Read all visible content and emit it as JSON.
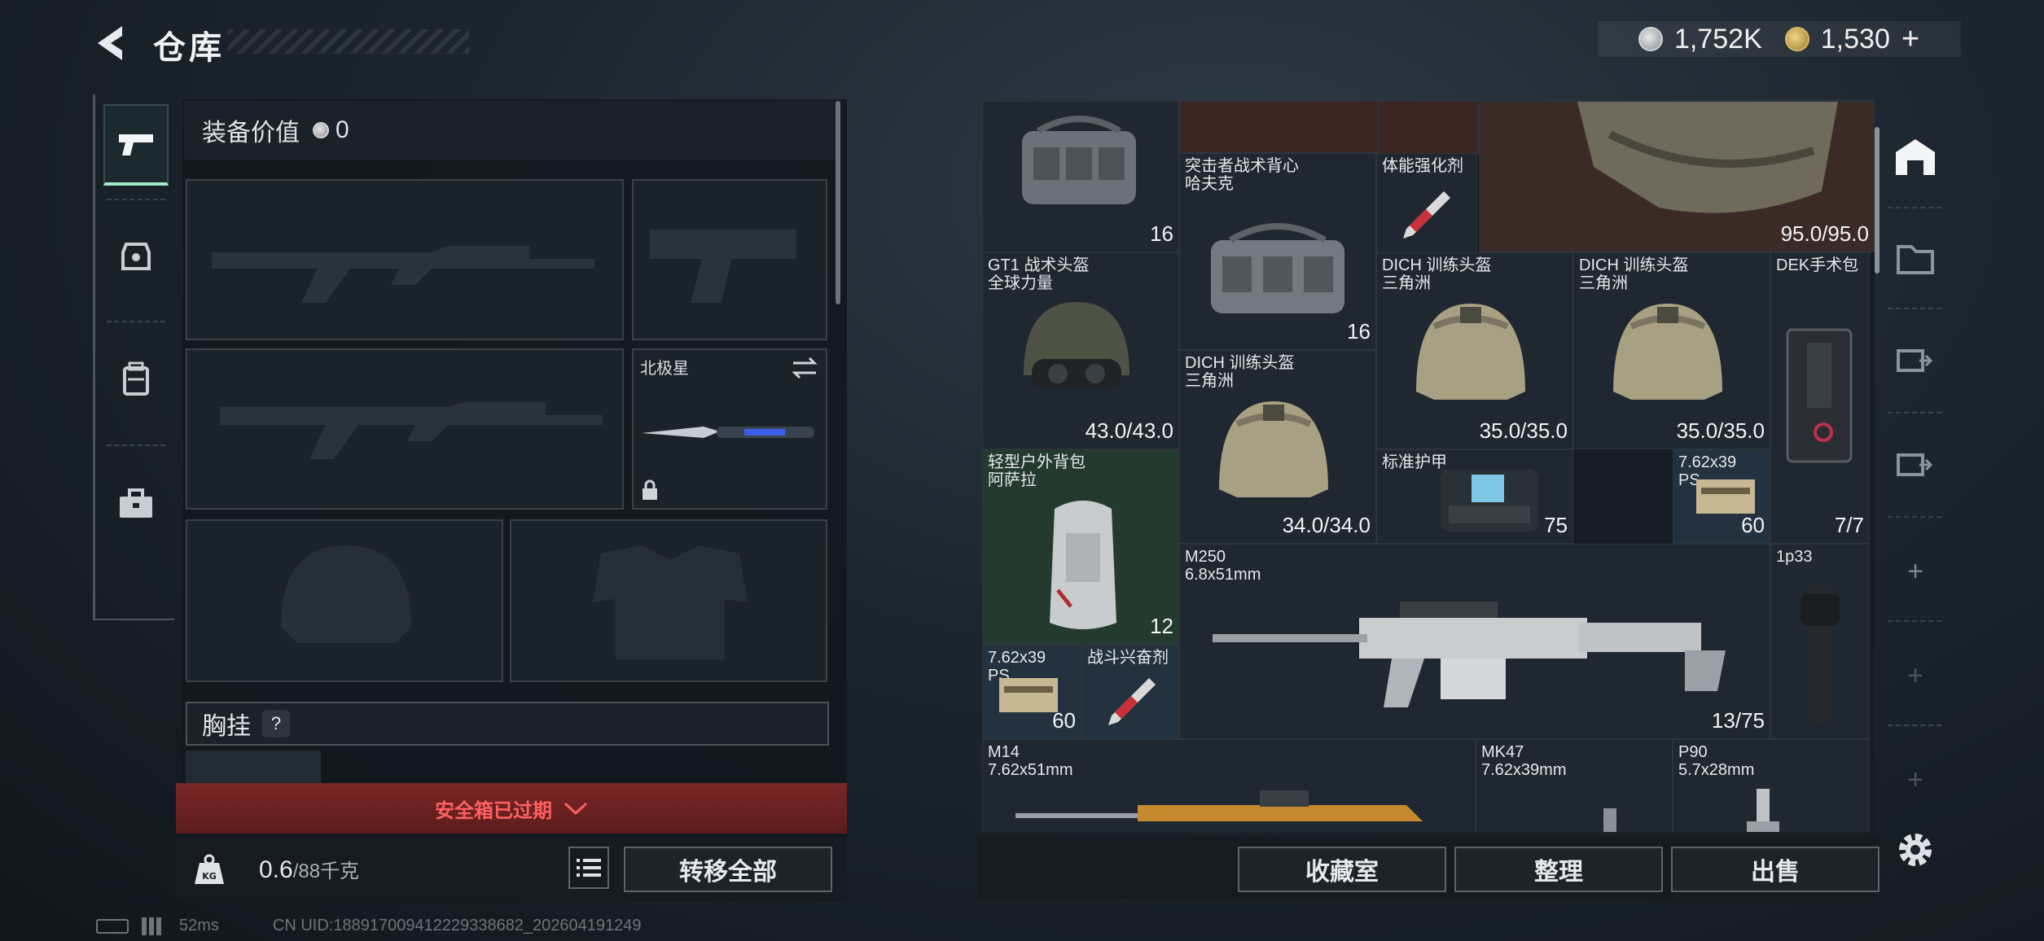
{
  "header": {
    "title": "仓库"
  },
  "currency": {
    "silver": "1,752K",
    "gold": "1,530",
    "add": "+"
  },
  "equipment": {
    "value_label": "装备价值",
    "value": "0",
    "melee_name": "北极星",
    "vest_label": "胸挂",
    "vest_help": "?",
    "alert": "安全箱已过期",
    "weight_value": "0.6",
    "weight_max": "/88千克",
    "kg": "KG",
    "transfer_all": "转移全部"
  },
  "inventory": {
    "cells": [
      {
        "name": "",
        "count": "16"
      },
      {
        "name": "突击者战术背心\n哈夫克",
        "count": "16"
      },
      {
        "name": "体能强化剂",
        "count": ""
      },
      {
        "name": "",
        "count": "95.0/95.0"
      },
      {
        "name": "GT1 战术头盔\n全球力量",
        "count": "43.0/43.0"
      },
      {
        "name": "DICH 训练头盔\n三角洲",
        "count": "35.0/35.0"
      },
      {
        "name": "DICH 训练头盔\n三角洲",
        "count": "35.0/35.0"
      },
      {
        "name": "DEK手术包",
        "count": ""
      },
      {
        "name": "DICH 训练头盔\n三角洲",
        "count": "34.0/34.0"
      },
      {
        "name": "轻型户外背包\n阿萨拉",
        "count": "12"
      },
      {
        "name": "标准护甲",
        "count": "75"
      },
      {
        "name": "7.62x39\nPS",
        "count": "60"
      },
      {
        "name": "",
        "count": "7/7"
      },
      {
        "name": "M250\n6.8x51mm",
        "count": "13/75"
      },
      {
        "name": "1p33",
        "count": ""
      },
      {
        "name": "7.62x39\nPS",
        "count": "60"
      },
      {
        "name": "战斗兴奋剂",
        "count": ""
      },
      {
        "name": "M14\n7.62x51mm",
        "count": ""
      },
      {
        "name": "MK47\n7.62x39mm",
        "count": ""
      },
      {
        "name": "P90\n5.7x28mm",
        "count": ""
      }
    ]
  },
  "actions": {
    "collection": "收藏室",
    "sort": "整理",
    "sell": "出售"
  },
  "status": {
    "ping": "52ms",
    "uid": "CN UID:188917009412229338682_202604191249"
  }
}
